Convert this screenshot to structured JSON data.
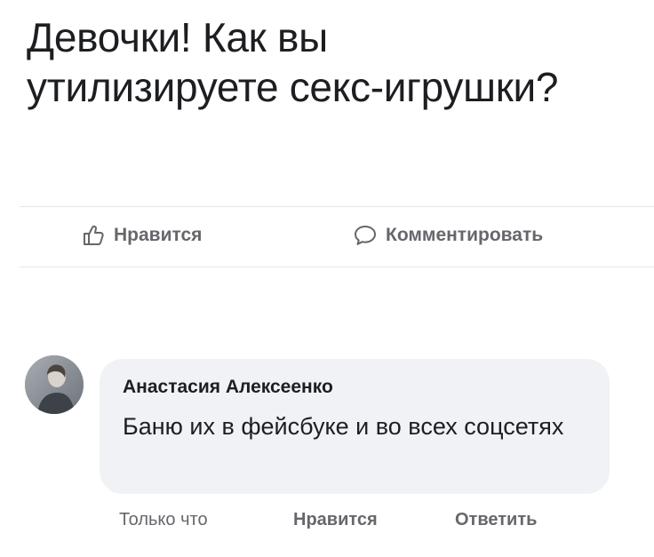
{
  "post": {
    "text": "Девочки! Как вы утилизируете секс-игрушки?"
  },
  "actions": {
    "like_label": "Нравится",
    "comment_label": "Комментировать"
  },
  "comment": {
    "author": "Анастасия Алексеенко",
    "text": "Баню их в фейсбуке и во всех соцсетях",
    "time": "Только что",
    "like_label": "Нравится",
    "reply_label": "Ответить"
  },
  "icons": {
    "like": "thumbs-up-icon",
    "comment": "speech-bubble-icon"
  },
  "colors": {
    "text": "#1c1e21",
    "secondary": "#65676b",
    "bubble": "#f0f2f5"
  }
}
